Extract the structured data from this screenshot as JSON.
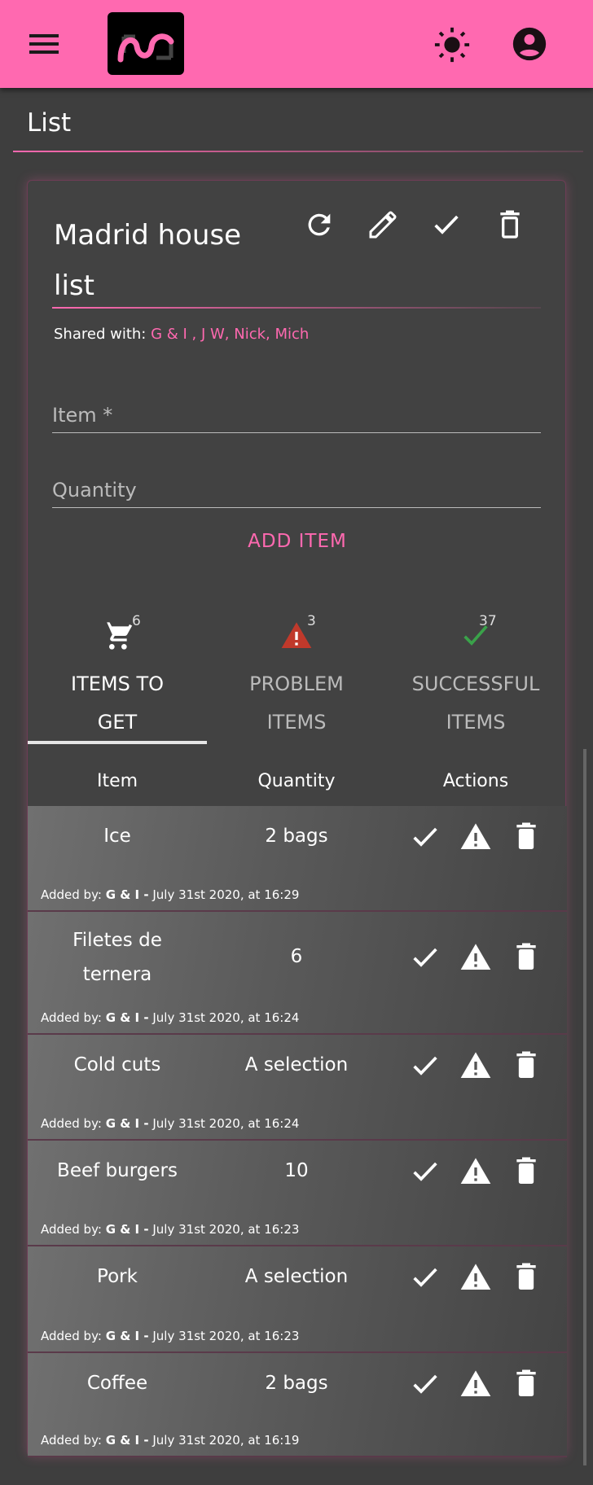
{
  "header": {
    "menu_icon": "hamburger-icon",
    "theme_icon": "sun-icon",
    "account_icon": "account-circle-icon",
    "accent": "#ff69b0"
  },
  "page": {
    "title": "List"
  },
  "list": {
    "title": "Madrid house list",
    "shared_label": "Shared with:",
    "shared_names": "G & I , J W, Nick, Mich",
    "actions": [
      "refresh-icon",
      "pencil-icon",
      "check-icon",
      "delete-icon"
    ]
  },
  "form": {
    "item_placeholder": "Item *",
    "quantity_placeholder": "Quantity",
    "add_label": "ADD ITEM"
  },
  "tabs": [
    {
      "label": "ITEMS TO GET",
      "count": "6",
      "icon": "cart-icon",
      "active": true
    },
    {
      "label": "PROBLEM ITEMS",
      "count": "3",
      "icon": "warning-icon",
      "color": "#c0392b"
    },
    {
      "label": "SUCCESSFUL ITEMS",
      "count": "37",
      "icon": "check-icon",
      "color": "#3aa24a"
    }
  ],
  "table": {
    "headers": [
      "Item",
      "Quantity",
      "Actions"
    ],
    "added_by_label": "Added by:",
    "rows": [
      {
        "name": "Ice",
        "quantity": "2 bags",
        "by": "G & I -",
        "date": "July 31st 2020, at 16:29"
      },
      {
        "name": "Filetes de ternera",
        "quantity": "6",
        "by": "G & I -",
        "date": "July 31st 2020, at 16:24"
      },
      {
        "name": "Cold cuts",
        "quantity": "A selection",
        "by": "G & I -",
        "date": "July 31st 2020, at 16:24"
      },
      {
        "name": "Beef burgers",
        "quantity": "10",
        "by": "G & I -",
        "date": "July 31st 2020, at 16:23"
      },
      {
        "name": "Pork",
        "quantity": "A selection",
        "by": "G & I -",
        "date": "July 31st 2020, at 16:23"
      },
      {
        "name": "Coffee",
        "quantity": "2 bags",
        "by": "G & I -",
        "date": "July 31st 2020, at 16:19"
      }
    ]
  }
}
